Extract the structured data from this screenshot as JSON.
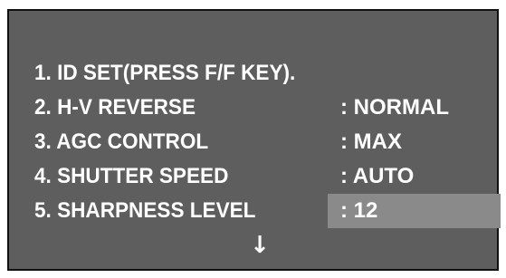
{
  "menu": {
    "items": [
      {
        "label": "1. ID SET(PRESS F/F KEY).",
        "value": ""
      },
      {
        "label": "2. H-V REVERSE",
        "value": ": NORMAL"
      },
      {
        "label": "3. AGC CONTROL",
        "value": ": MAX"
      },
      {
        "label": "4. SHUTTER SPEED",
        "value": ": AUTO"
      },
      {
        "label": "5. SHARPNESS LEVEL",
        "value": ": 12"
      }
    ],
    "selected_index": 4,
    "scroll_indicator": "↓",
    "scroll_indicator_icon": "arrow-down-icon"
  },
  "colors": {
    "screen_background": "#5e5e5e",
    "text": "#ffffff",
    "selection_highlight": "#8a8a8a",
    "border": "#111111"
  }
}
